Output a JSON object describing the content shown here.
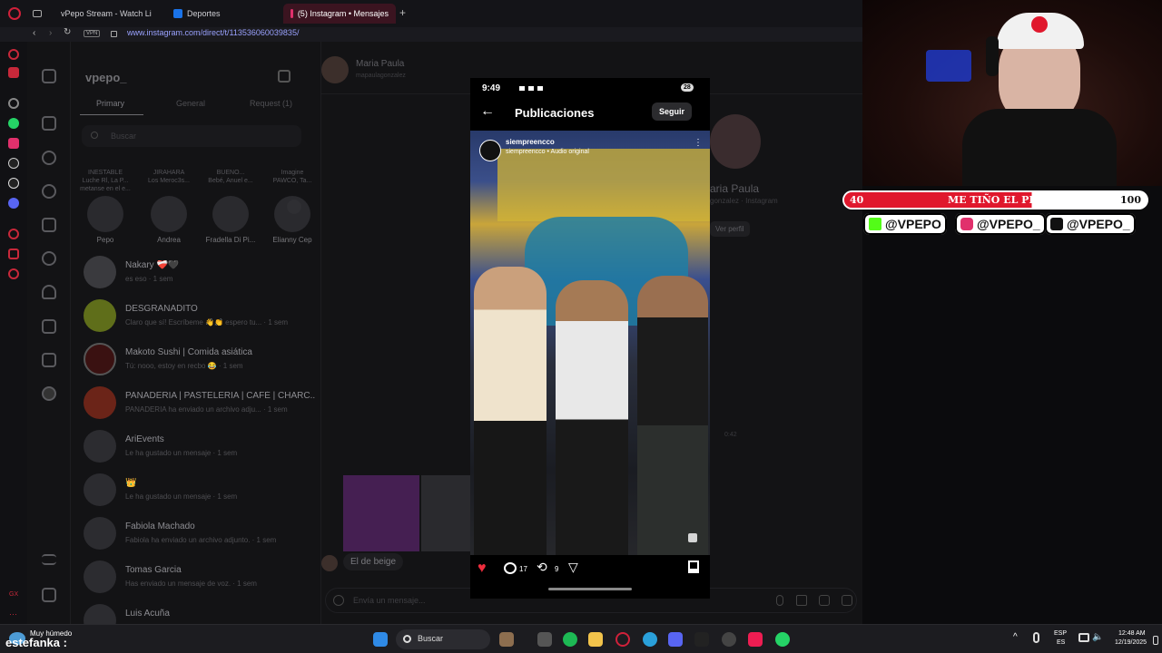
{
  "browser": {
    "tabs": [
      {
        "label": "vPepo Stream - Watch Li",
        "color": "#53fc18"
      },
      {
        "label": "Deportes",
        "color": "#1a73e8"
      },
      {
        "label": "(5) Instagram • Mensajes",
        "color": "#e1306c",
        "active": true
      }
    ],
    "new_tab": "+",
    "vpn": "VPN",
    "url": "www.instagram.com/direct/t/113536060039835/"
  },
  "inbox": {
    "account": "vpepo_",
    "tabs": [
      "Primary",
      "General",
      "Request (1)"
    ],
    "search_placeholder": "Buscar",
    "notes": [
      {
        "bubble": "INESTABLE\nLuche Rl, La P...\nmetanse en el e...",
        "name": "Pepo"
      },
      {
        "bubble": "JIRAHARA\nLos Meroc3s...",
        "name": "Andrea"
      },
      {
        "bubble": "BUENO...\nBebé, Anuel e...",
        "name": "Fradella Di Pi..."
      },
      {
        "bubble": "Imagine\nPAWCO, Ta...",
        "name": "Elianny Cep"
      }
    ],
    "conversations": [
      {
        "name": "Nakary ❤️‍🩹🖤",
        "preview": "es eso · 1 sem",
        "color": "#3a3a3e"
      },
      {
        "name": "DESGRANADITO",
        "preview": "Claro que sí! Escríbeme 👋👏 espero tu... · 1 sem",
        "color": "#5f6e1a"
      },
      {
        "name": "Makoto Sushi | Comida asiática",
        "preview": "Tú: nooo, estoy en recbo 😂 · 1 sem",
        "color": "#3a1111"
      },
      {
        "name": "PANADERIA | PASTELERIA | CAFÉ | CHARC...",
        "preview": "PANADERIA ha enviado un archivo adju... · 1 sem",
        "color": "#6b2418"
      },
      {
        "name": "AriEvents",
        "preview": "Le ha gustado un mensaje · 1 sem",
        "color": "#2d2d31"
      },
      {
        "name": "👑",
        "preview": "Le ha gustado un mensaje · 1 sem",
        "color": "#2a2623"
      },
      {
        "name": "Fabiola Machado",
        "preview": "Fabiola ha enviado un archivo adjunto. · 1 sem",
        "color": "#332b27"
      },
      {
        "name": "Tomas Garcia",
        "preview": "Has enviado un mensaje de voz. · 1 sem",
        "color": "#2b2b2e"
      },
      {
        "name": "Luis Acuña",
        "preview": "",
        "color": "#2b2b2e"
      }
    ]
  },
  "chat": {
    "contact_name": "Maria Paula",
    "contact_handle": "mapaulagonzalez",
    "profile_name": "aria Paula",
    "profile_sub": "gonzalez · Instagram",
    "view_profile": "Ver perfil",
    "time_stamp": "0:42",
    "reply_text": "El de beige",
    "message_placeholder": "Envía un mensaje..."
  },
  "phone": {
    "time": "9:49",
    "battery": "28",
    "header_title": "Publicaciones",
    "follow_button": "Seguir",
    "post_user": "siempreencco",
    "post_audio": "siempreencco • Audio original",
    "comments": "17",
    "reposts": "9",
    "like_color": "#ed2d3d"
  },
  "overlay": {
    "goal_start": "40",
    "goal_title": "ME TIÑO EL PELO",
    "goal_end": "100",
    "goal_progress": 0.02,
    "socials": [
      "@VPEPO",
      "@VPEPO_",
      "@VPEPO_"
    ]
  },
  "taskbar": {
    "weather": "Muy húmedo",
    "chat_user": "estefanka :",
    "search": "Buscar",
    "lang1": "ESP",
    "lang2": "ES",
    "time": "12:48 AM",
    "date": "12/19/2025"
  }
}
